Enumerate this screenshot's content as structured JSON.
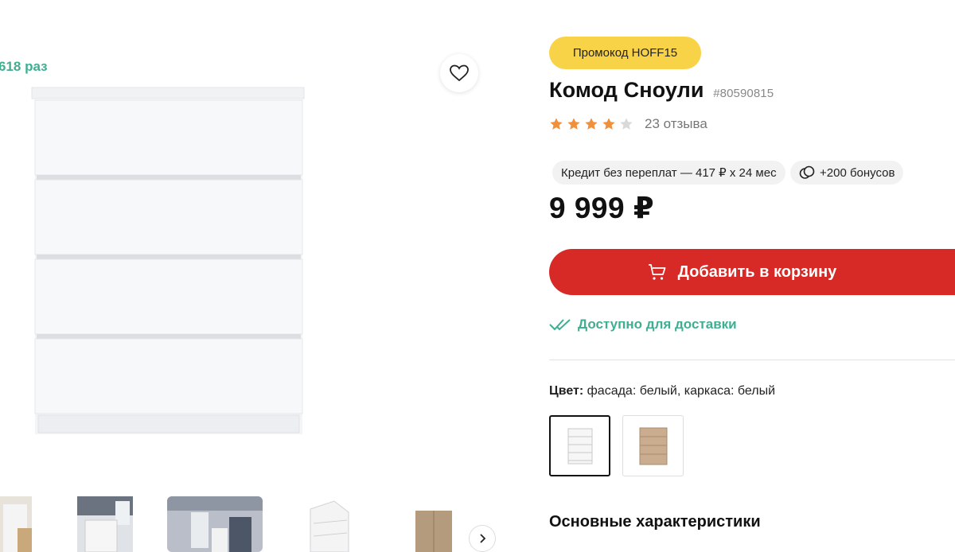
{
  "gallery": {
    "views_text": "618 раз",
    "favorite_icon": "heart-icon",
    "next_icon": "chevron-right-icon"
  },
  "product": {
    "promo": "Промокод HOFF15",
    "title": "Комод Сноули",
    "sku": "#80590815",
    "rating": 4,
    "rating_max": 5,
    "reviews": "23 отзыва",
    "credit": "Кредит без переплат — 417 ₽ x 24 мес",
    "bonus": "+200 бонусов",
    "price": "9 999 ₽",
    "add_to_cart": "Добавить в корзину",
    "delivery": "Доступно для доставки",
    "color_label": "Цвет:",
    "color_value": "фасада: белый, каркаса: белый",
    "color_options": [
      "white",
      "oak"
    ],
    "selected_color": "white",
    "characteristics_title": "Основные характеристики"
  },
  "colors": {
    "accent_red": "#d72a26",
    "promo_yellow": "#f8d348",
    "green": "#3fae91",
    "star_orange": "#f0903a",
    "star_empty": "#d9d9d9"
  }
}
